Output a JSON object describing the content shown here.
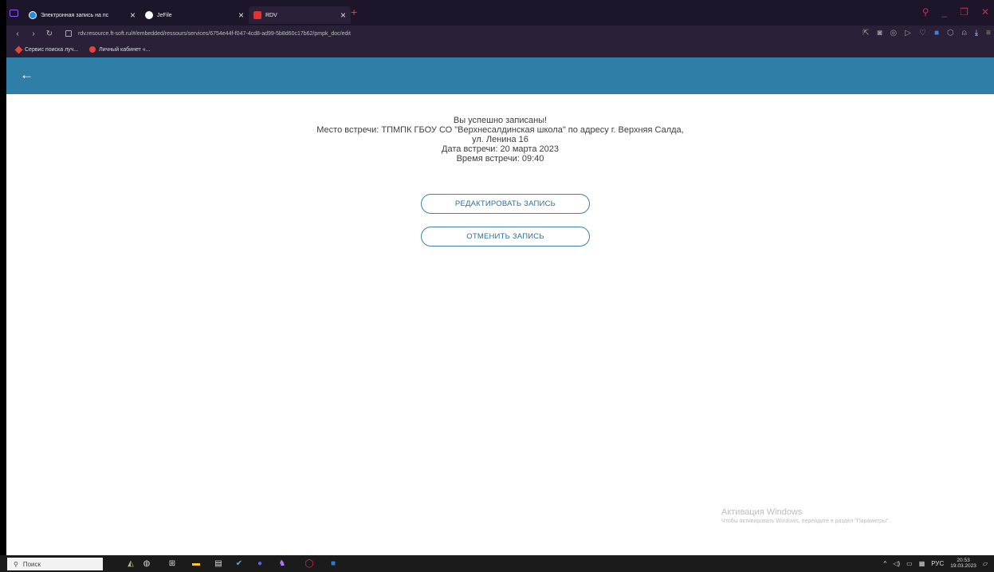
{
  "browser": {
    "tabs": [
      {
        "title": "Электронная запись на пс",
        "close": "×"
      },
      {
        "title": "JeFile",
        "close": "×"
      },
      {
        "title": "RDV",
        "close": "×"
      }
    ],
    "new_tab": "+",
    "url": "rdv.resource.ft-soft.ru/#/embedded/ressours/services/6754e44f-f047-4cd8-ad99-5b8d60c17b62/pmpk_doc/edit",
    "bookmarks": [
      "Сервис поиска луч...",
      "Личный кабинет «..."
    ]
  },
  "app": {
    "back_glyph": "←"
  },
  "message": {
    "line1": "Вы успешно записаны!",
    "line2": "Место встречи: ТПМПК ГБОУ СО \"Верхнесалдинская школа\" по адресу г. Верхняя Салда,",
    "line3": "ул. Ленина 16",
    "line4": "Дата встречи: 20 марта 2023",
    "line5": "Время встречи: 09:40"
  },
  "buttons": {
    "edit": "РЕДАКТИРОВАТЬ ЗАПИСЬ",
    "cancel": "ОТМЕНИТЬ ЗАПИСЬ"
  },
  "watermark": {
    "title": "Активация Windows",
    "subtitle": "Чтобы активировать Windows, перейдите в раздел \"Параметры\"."
  },
  "taskbar": {
    "search_label": "Поиск",
    "lang": "РУС",
    "time": "20:53",
    "date": "19.03.2023"
  },
  "colors": {
    "appbar": "#2e7ea8",
    "button_border": "#3f7fa8",
    "button_text": "#2c6f98"
  }
}
